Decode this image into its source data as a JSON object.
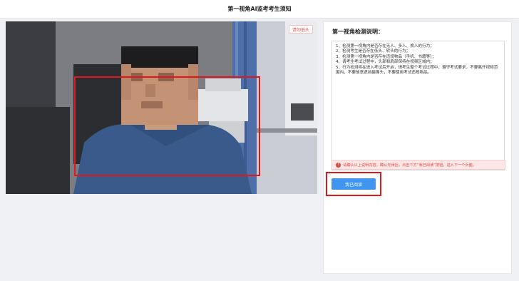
{
  "header": {
    "title": "第一视角AI监考考生须知"
  },
  "camera": {
    "switch_label": "请勿低头"
  },
  "instructions": {
    "title": "第一视角检测说明：",
    "lines": [
      "1、检测第一视角内是否存在无人、多人、换人的行为；",
      "2、检测考生是否存在低头、转头的行为；",
      "3、检测第一视角内是否存在违规物品（手机、书籍等）；",
      "4、请考生考试过程中，头部和肩部保持在视频区域内；",
      "5、行为检测将在进入考试后开启，请考生整个考试过程中，遵守考试要求，不要离开视频范围内，不要故意遮挡摄像头，不要使用考试违规物品。"
    ]
  },
  "alert": {
    "icon": "!",
    "text": "请确认以上说明内容，确认无误后，点击下方“我已阅读”按钮，进入下一个页面。"
  },
  "confirm": {
    "label": "我已阅读"
  },
  "colors": {
    "accent": "#3f95f0",
    "warning": "#e2493f",
    "highlight": "#e3161c"
  }
}
